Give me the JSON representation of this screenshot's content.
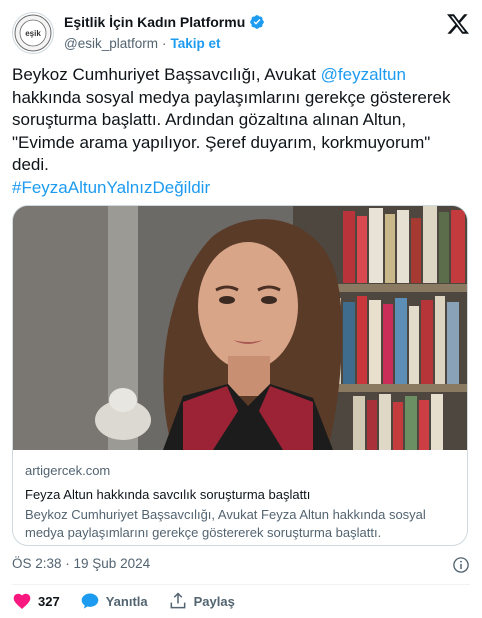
{
  "account": {
    "display_name": "Eşitlik İçin Kadın Platformu",
    "handle": "@esik_platform",
    "separator": "·",
    "follow_label": "Takip et",
    "avatar_text": "eşik"
  },
  "tweet": {
    "text_1": "Beykoz Cumhuriyet Başsavcılığı, Avukat ",
    "mention": "@feyzaltun",
    "text_2": " hakkında sosyal medya paylaşımlarını gerekçe göstererek soruşturma başlattı. Ardından gözaltına alınan Altun, \"Evimde arama yapılıyor. Şeref duyarım, korkmuyorum\" dedi.",
    "hashtag": "#FeyzaAltunYalnızDeğildir"
  },
  "card": {
    "domain": "artigercek.com",
    "title": "Feyza Altun hakkında savcılık soruşturma başlattı",
    "description": "Beykoz Cumhuriyet Başsavcılığı, Avukat Feyza Altun hakkında sosyal medya paylaşımlarını gerekçe göstererek soruşturma başlattı."
  },
  "timestamp": "ÖS 2:38 · 19 Şub 2024",
  "actions": {
    "likes": "327",
    "reply_label": "Yanıtla",
    "share_label": "Paylaş"
  },
  "colors": {
    "accent": "#1d9bf0",
    "like": "#f91880",
    "text": "#0f1419",
    "muted": "#536471"
  },
  "icons": [
    "verified-badge-icon",
    "x-logo-icon",
    "info-icon",
    "heart-icon",
    "reply-icon",
    "share-icon"
  ]
}
